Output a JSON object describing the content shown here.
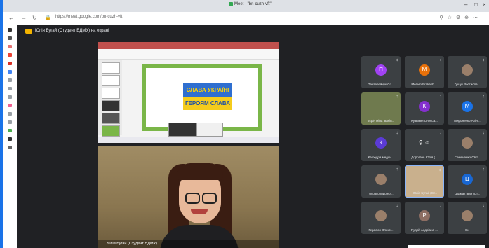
{
  "browser": {
    "title": "Meet - \"bn-cuzh-vft\"",
    "url": "https://meet.google.com/bn-cuzh-vft",
    "window_controls": [
      "–",
      "□",
      "×"
    ]
  },
  "meet": {
    "presenter_banner": "Юлія Бугай (Студент ЕДМУ) на екрані",
    "slide_text_top": "СЛАВА УКРАЇНІ",
    "slide_text_bottom": "ГЕРОЯМ СЛАВА",
    "camera_label": "Юлія Бугай (Студент ЄДМУ)"
  },
  "participants": [
    {
      "name": "Пантелейчук Со...",
      "initial": "П",
      "color": "#a142f4"
    },
    {
      "name": "Merwin Prakash ...",
      "initial": "M",
      "color": "#e8710a"
    },
    {
      "name": "Гущук Ростисла...",
      "initial": "",
      "color": "photo"
    },
    {
      "name": "Бєрін Ніна Іванів...",
      "initial": "",
      "color": "video"
    },
    {
      "name": "Кузьмин Олекса...",
      "initial": "К",
      "color": "#8430ce"
    },
    {
      "name": "Мироненко Алін...",
      "initial": "М",
      "color": "#1a73e8"
    },
    {
      "name": "Кафедра медич...",
      "initial": "К",
      "color": "#5b3bd6"
    },
    {
      "name": "Дорогань Юлія (...",
      "initial": "",
      "color": "icons"
    },
    {
      "name": "Семененко Світ...",
      "initial": "",
      "color": "photo"
    },
    {
      "name": "Головко Мирясл...",
      "initial": "",
      "color": "photo"
    },
    {
      "name": "Юлія Бугай (Ст...",
      "initial": "",
      "color": "photo-hl"
    },
    {
      "name": "Цудмак Іван (Ст...",
      "initial": "Ц",
      "color": "#1967d2"
    },
    {
      "name": "Герасюк Олекс...",
      "initial": "",
      "color": "photo"
    },
    {
      "name": "Рудяй Андріана ...",
      "initial": "Р",
      "color": "#8d6e63"
    },
    {
      "name": "Ви",
      "initial": "",
      "color": "photo"
    }
  ]
}
